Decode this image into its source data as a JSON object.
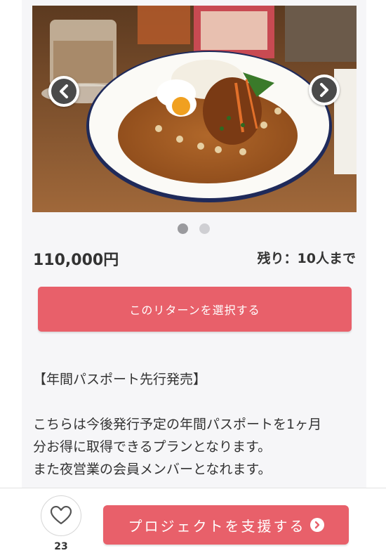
{
  "carousel": {
    "image_alt": "curry-plate-photo",
    "prev_icon": "chevron-left-icon",
    "next_icon": "chevron-right-icon",
    "slide_count": 2,
    "active_slide": 1
  },
  "reward": {
    "price": "110,000円",
    "remaining": "残り：10人まで",
    "select_label": "このリターンを選択する"
  },
  "description": {
    "lines": [
      "【年間パスポート先行発売】",
      "",
      "こちらは今後発行予定の年間パスポートを1ヶ月",
      "分お得に取得できるプランとなります。",
      "また夜営業の会員メンバーとなれます。"
    ]
  },
  "bottom_bar": {
    "like_icon": "heart-icon",
    "like_count": "23",
    "support_label": "プロジェクトを支援する",
    "support_icon": "arrow-circle-right-icon"
  },
  "colors": {
    "accent": "#e8606a",
    "card_bg": "#f6f6f8",
    "text": "#333333"
  }
}
